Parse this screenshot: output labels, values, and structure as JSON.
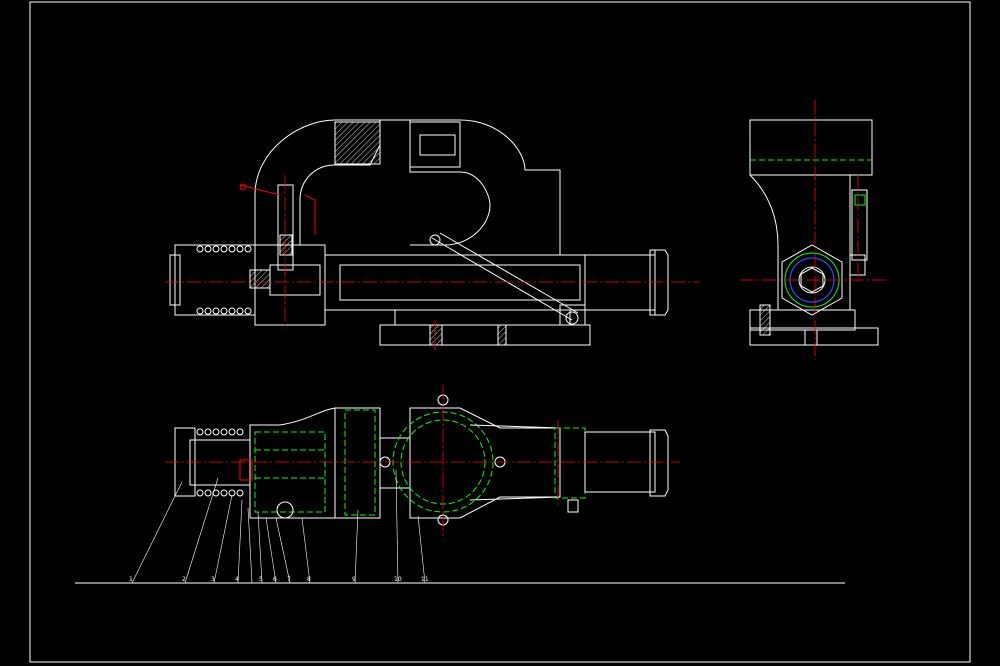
{
  "drawing": {
    "background": "#000000",
    "line_colors": {
      "outline": "#ffffff",
      "hidden": "#00ff00",
      "centerline": "#ff0000",
      "thread": "#3344ff"
    },
    "views": [
      "front-view",
      "side-view",
      "top-view"
    ],
    "balloons": [
      "1",
      "2",
      "3",
      "4",
      "5",
      "6",
      "7",
      "8",
      "9",
      "10",
      "11"
    ]
  }
}
